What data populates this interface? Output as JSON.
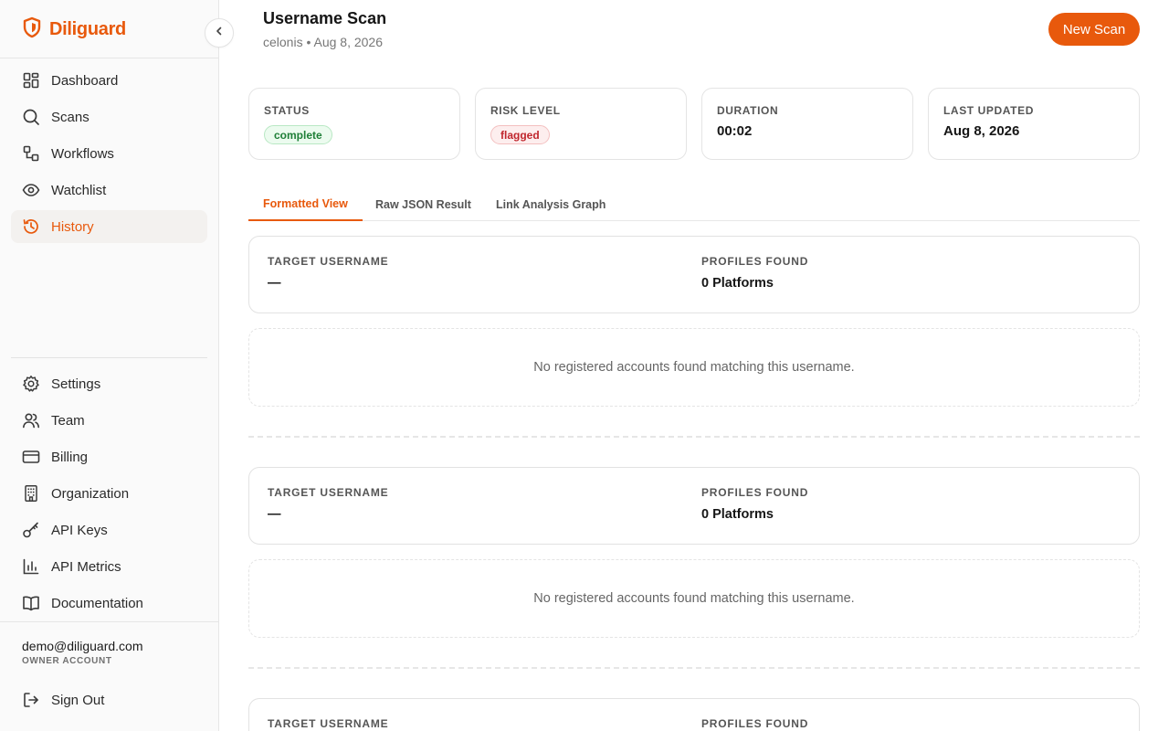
{
  "brand": {
    "name": "Diliguard",
    "accent": "#e8590c"
  },
  "sidebar": {
    "collapse_icon": "chevron-left-icon",
    "items_top": [
      {
        "label": "Dashboard",
        "icon": "dashboard-icon",
        "active": false
      },
      {
        "label": "Scans",
        "icon": "search-icon",
        "active": false
      },
      {
        "label": "Workflows",
        "icon": "workflow-icon",
        "active": false
      },
      {
        "label": "Watchlist",
        "icon": "eye-icon",
        "active": false
      },
      {
        "label": "History",
        "icon": "history-icon",
        "active": true
      }
    ],
    "items_bottom": [
      {
        "label": "Settings",
        "icon": "gear-icon"
      },
      {
        "label": "Team",
        "icon": "team-icon"
      },
      {
        "label": "Billing",
        "icon": "credit-card-icon"
      },
      {
        "label": "Organization",
        "icon": "building-icon"
      },
      {
        "label": "API Keys",
        "icon": "key-icon"
      },
      {
        "label": "API Metrics",
        "icon": "bar-chart-icon"
      },
      {
        "label": "Documentation",
        "icon": "book-icon"
      }
    ],
    "account": {
      "email": "demo@diliguard.com",
      "role": "OWNER ACCOUNT"
    },
    "signout": {
      "label": "Sign Out",
      "icon": "sign-out-icon"
    }
  },
  "header": {
    "title": "Username Scan",
    "meta": "celonis • Aug 8, 2026",
    "new_scan_label": "New Scan"
  },
  "stats": {
    "status": {
      "label": "STATUS",
      "value": "complete",
      "color": "#1e7f37"
    },
    "risk": {
      "label": "RISK LEVEL",
      "value": "flagged",
      "color": "#c0262d"
    },
    "duration": {
      "label": "DURATION",
      "value": "00:02"
    },
    "updated": {
      "label": "LAST UPDATED",
      "value": "Aug 8, 2026"
    }
  },
  "tabs": [
    {
      "label": "Formatted View",
      "active": true
    },
    {
      "label": "Raw JSON Result",
      "active": false
    },
    {
      "label": "Link Analysis Graph",
      "active": false
    }
  ],
  "results": [
    {
      "target_label": "TARGET USERNAME",
      "target_value": "—",
      "profiles_label": "PROFILES FOUND",
      "profiles_value": "0 Platforms",
      "empty_message": "No registered accounts found matching this username."
    },
    {
      "target_label": "TARGET USERNAME",
      "target_value": "—",
      "profiles_label": "PROFILES FOUND",
      "profiles_value": "0 Platforms",
      "empty_message": "No registered accounts found matching this username."
    },
    {
      "target_label": "TARGET USERNAME",
      "target_value": "",
      "profiles_label": "PROFILES FOUND",
      "profiles_value": "",
      "empty_message": ""
    }
  ]
}
